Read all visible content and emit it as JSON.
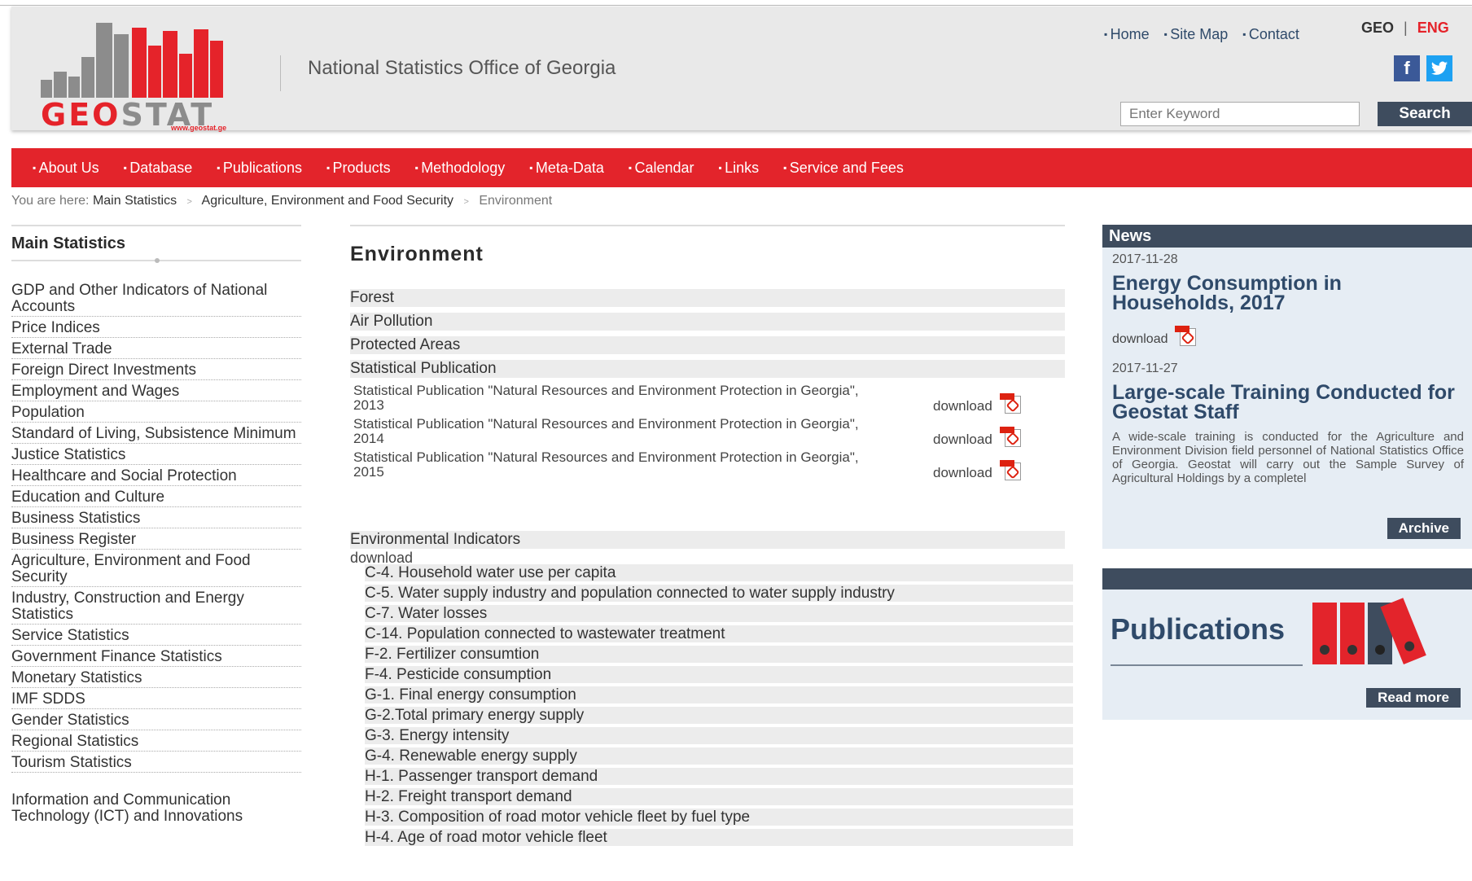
{
  "header": {
    "logo_text_red": "GEO",
    "logo_text_grey": "STAT",
    "logo_url": "www.geostat.ge",
    "site_name": "National Statistics Office of Georgia",
    "top_links": [
      "Home",
      "Site Map",
      "Contact"
    ],
    "lang_geo": "GEO",
    "lang_sep": "|",
    "lang_eng": "ENG",
    "social": {
      "facebook": "facebook-icon",
      "twitter": "twitter-icon"
    },
    "search_placeholder": "Enter Keyword",
    "search_label": "Search"
  },
  "nav": [
    "About Us",
    "Database",
    "Publications",
    "Products",
    "Methodology",
    "Meta-Data",
    "Calendar",
    "Links",
    "Service and Fees"
  ],
  "breadcrumb": {
    "prefix": "You are here:",
    "items": [
      "Main Statistics",
      "Agriculture, Environment and Food Security",
      "Environment"
    ],
    "separator": ">"
  },
  "sidebar": {
    "title": "Main Statistics",
    "items": [
      "GDP and Other Indicators of National Accounts",
      "Price Indices",
      "External Trade",
      "Foreign Direct Investments",
      "Employment and Wages",
      "Population",
      "Standard of Living, Subsistence Minimum",
      "Justice Statistics",
      "Healthcare and Social Protection",
      "Education and Culture",
      "Business Statistics",
      "Business Register",
      "Agriculture, Environment and Food Security",
      "Industry, Construction and Energy Statistics",
      "Service Statistics",
      "Government Finance Statistics",
      "Monetary Statistics",
      "IMF SDDS",
      "Gender Statistics",
      "Regional Statistics",
      "Tourism Statistics",
      "Information and Communication Technology (ICT) and Innovations"
    ]
  },
  "main": {
    "title": "Environment",
    "categories": [
      "Forest",
      "Air Pollution",
      "Protected Areas",
      "Statistical Publication"
    ],
    "publications": [
      {
        "title": "Statistical Publication \"Natural Resources and Environment Protection in Georgia\", 2013",
        "download": "download"
      },
      {
        "title": "Statistical Publication \"Natural Resources and Environment Protection in Georgia\", 2014",
        "download": "download"
      },
      {
        "title": "Statistical Publication \"Natural Resources and Environment Protection in Georgia\", 2015",
        "download": "download"
      }
    ],
    "indicators_heading": "Environmental Indicators",
    "indicators_download": "download",
    "indicators": [
      "C-4. Household water use per capita",
      "C-5. Water supply industry and population connected to water supply industry",
      "C-7. Water losses",
      "C-14. Population connected to wastewater treatment",
      "F-2. Fertilizer consumtion",
      "F-4. Pesticide consumption",
      "G-1. Final energy consumption",
      "G-2.Total primary energy supply",
      "G-3. Energy intensity",
      "G-4. Renewable energy supply",
      "H-1. Passenger transport demand",
      "H-2. Freight transport demand",
      "H-3. Composition of road motor vehicle fleet by fuel type",
      "H-4. Age of road motor vehicle fleet"
    ]
  },
  "news": {
    "heading": "News",
    "items": [
      {
        "date": "2017-11-28",
        "title": "Energy Consumption in Households, 2017",
        "download": "download"
      },
      {
        "date": "2017-11-27",
        "title": "Large-scale Training Conducted for Geostat Staff",
        "text": "A wide-scale training is conducted for the Agriculture and Environment Division field personnel of National Statistics Office of Georgia. Geostat will carry out the Sample Survey of Agricultural Holdings by a completel"
      }
    ],
    "archive_label": "Archive"
  },
  "publications_box": {
    "title": "Publications",
    "read_more": "Read more"
  },
  "colors": {
    "brand_red": "#e3242b",
    "dark_slate": "#3e4c5e",
    "title_blue": "#2f4a6a",
    "panel_bg": "#e6edf4"
  }
}
